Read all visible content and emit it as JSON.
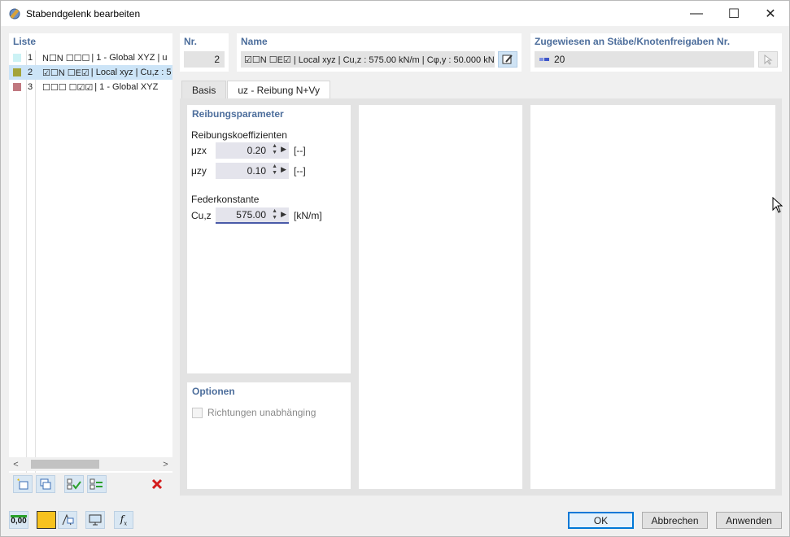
{
  "window": {
    "title": "Stabendgelenk bearbeiten",
    "minimize": "—",
    "maximize": "☐",
    "close": "✕"
  },
  "list": {
    "header": "Liste",
    "items": [
      {
        "num": "1",
        "text": "| 1 - Global XYZ | u",
        "color": "#ccf2f5",
        "checks": "N☐N ☐☐☐"
      },
      {
        "num": "2",
        "text": "| Local xyz | Cu,z : 5",
        "color": "#a4a43a",
        "checks": "☑☐N ☐E☑",
        "selected": true
      },
      {
        "num": "3",
        "text": "| 1 - Global XYZ",
        "color": "#c07880",
        "checks": "☐☐☐ ☐☑☑"
      }
    ],
    "scroll_left": "<",
    "scroll_right": ">"
  },
  "nr": {
    "header": "Nr.",
    "value": "2"
  },
  "name": {
    "header": "Name",
    "value": "☑☐N ☐E☑ | Local xyz | Cu,z : 575.00 kN/m | Cφ,y : 50.000 kN"
  },
  "assigned": {
    "header": "Zugewiesen an Stäbe/Knotenfreigaben Nr.",
    "value": "20"
  },
  "tabs": [
    {
      "label": "Basis",
      "active": false
    },
    {
      "label": "uz - Reibung N+Vy",
      "active": true
    }
  ],
  "friction": {
    "section": "Reibungsparameter",
    "coef_label": "Reibungskoeffizienten",
    "mu_zx": {
      "name": "μzx",
      "value": "0.20",
      "unit": "[--]"
    },
    "mu_zy": {
      "name": "μzy",
      "value": "0.10",
      "unit": "[--]"
    },
    "spring_label": "Federkonstante",
    "cuz": {
      "name": "Cu,z",
      "value": "575.00",
      "unit": "[kN/m]"
    }
  },
  "options": {
    "section": "Optionen",
    "independent": "Richtungen unabhänging"
  },
  "buttons": {
    "ok": "OK",
    "cancel": "Abbrechen",
    "apply": "Anwenden"
  },
  "bottom_icons": {
    "units": "0,00"
  },
  "colors": {
    "accent": "#4d6e9c",
    "selection": "#cce4f7",
    "tool_blue": "#d9e7f3"
  }
}
